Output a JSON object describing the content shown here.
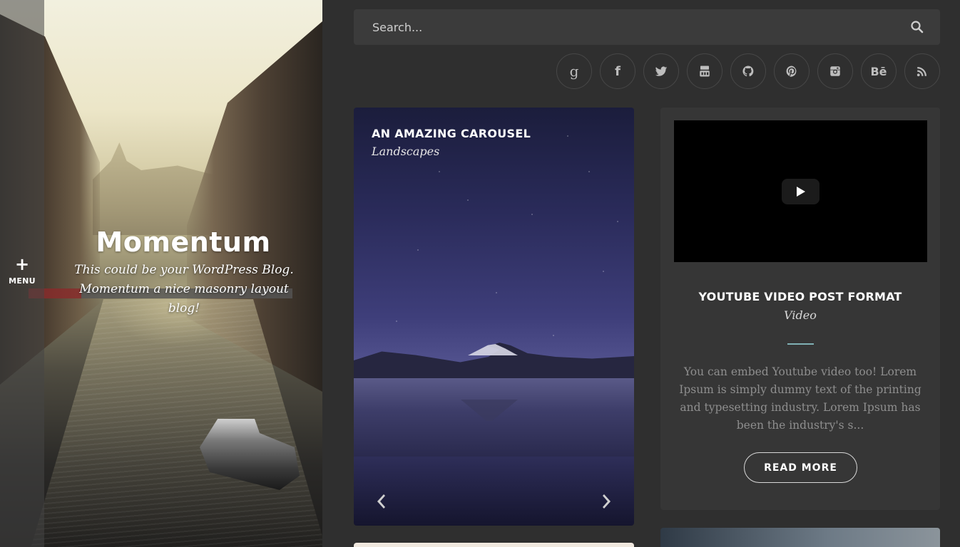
{
  "hero": {
    "menu_label": "MENU",
    "menu_icon": "plus-icon",
    "site_title": "Momentum",
    "tagline": "This could be your WordPress Blog. Momentum a nice masonry layout blog!"
  },
  "search": {
    "placeholder": "Search...",
    "icon": "search-icon"
  },
  "socials": [
    {
      "name": "google-plus",
      "glyph": "g"
    },
    {
      "name": "facebook",
      "glyph": "f"
    },
    {
      "name": "twitter",
      "glyph": ""
    },
    {
      "name": "youtube",
      "glyph": ""
    },
    {
      "name": "github",
      "glyph": ""
    },
    {
      "name": "pinterest",
      "glyph": ""
    },
    {
      "name": "instagram",
      "glyph": ""
    },
    {
      "name": "behance",
      "glyph": "Bē"
    },
    {
      "name": "rss",
      "glyph": ""
    }
  ],
  "posts": {
    "carousel": {
      "title": "AN AMAZING CAROUSEL",
      "category": "Landscapes"
    },
    "video": {
      "title": "YOUTUBE VIDEO POST FORMAT",
      "category": "Video",
      "excerpt": "You can embed Youtube video too! Lorem Ipsum is simply dummy text of the printing and typesetting industry. Lorem Ipsum has been the industry's s...",
      "read_more": "READ MORE"
    }
  },
  "colors": {
    "background": "#2f2f2f",
    "card": "#363636",
    "accent_divider": "#7fb0b4"
  }
}
